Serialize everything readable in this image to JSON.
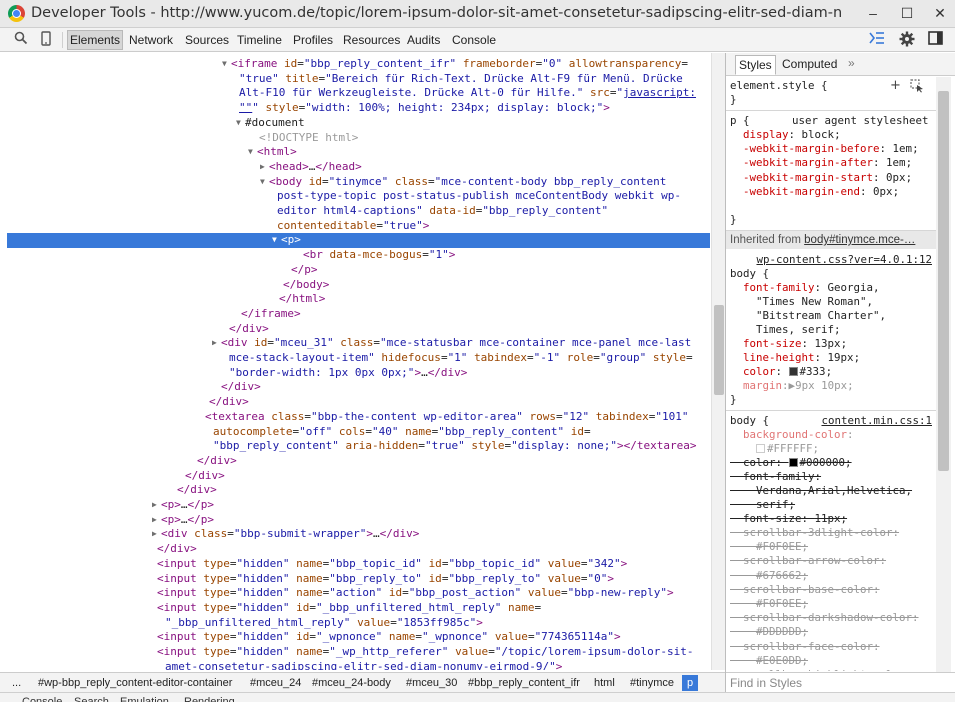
{
  "window": {
    "title": "Developer Tools - http://www.yucom.de/topic/lorem-ipsum-dolor-sit-amet-consetetur-sadipscing-elitr-sed-diam-nonumy...",
    "minimize": "–",
    "maximize": "☐",
    "close": "✕"
  },
  "toolbar": {
    "tabs": [
      "Elements",
      "Network",
      "Sources",
      "Timeline",
      "Profiles",
      "Resources",
      "Audits",
      "Console"
    ],
    "active_tab": "Elements"
  },
  "dom_rows": [
    {
      "t": "▼",
      "segs": [
        [
          "tg",
          "<iframe "
        ],
        [
          "an",
          "id"
        ],
        [
          "tx",
          "="
        ],
        [
          "av",
          "\"bbp_reply_content_ifr\""
        ],
        [
          "tx",
          " "
        ],
        [
          "an",
          "frameborder"
        ],
        [
          "tx",
          "="
        ],
        [
          "av",
          "\"0\""
        ],
        [
          "tx",
          " "
        ],
        [
          "an",
          "allowtransparency"
        ],
        [
          "tx",
          "="
        ]
      ]
    },
    {
      "segs": [
        [
          "av",
          "\"true\""
        ],
        [
          "tx",
          " "
        ],
        [
          "an",
          "title"
        ],
        [
          "tx",
          "="
        ],
        [
          "av",
          "\"Bereich für Rich-Text. Drücke Alt-F9 für Menü. Drücke"
        ]
      ]
    },
    {
      "segs": [
        [
          "av",
          "Alt-F10 für Werkzeugleiste. Drücke Alt-0 für Hilfe.\""
        ],
        [
          "tx",
          " "
        ],
        [
          "an",
          "src"
        ],
        [
          "tx",
          "="
        ],
        [
          "av",
          "\""
        ],
        [
          "lk",
          "javascript:"
        ]
      ]
    },
    {
      "segs": [
        [
          "lk",
          "\"\""
        ],
        [
          "av",
          "\""
        ],
        [
          "tx",
          " "
        ],
        [
          "an",
          "style"
        ],
        [
          "tx",
          "="
        ],
        [
          "av",
          "\"width: 100%; height: 234px; display: block;\""
        ],
        [
          "tg",
          ">"
        ]
      ]
    },
    {
      "t": "▼",
      "segs": [
        [
          "tx",
          "#document"
        ]
      ]
    },
    {
      "segs": [
        [
          "cm",
          "<!DOCTYPE html>"
        ]
      ]
    },
    {
      "t": "▼",
      "segs": [
        [
          "tg",
          "<html>"
        ]
      ]
    },
    {
      "t": "▶",
      "segs": [
        [
          "tg",
          "<head>"
        ],
        [
          "tx",
          "…"
        ],
        [
          "tg",
          "</head>"
        ]
      ]
    },
    {
      "t": "▼",
      "segs": [
        [
          "tg",
          "<body "
        ],
        [
          "an",
          "id"
        ],
        [
          "tx",
          "="
        ],
        [
          "av",
          "\"tinymce\""
        ],
        [
          "tx",
          " "
        ],
        [
          "an",
          "class"
        ],
        [
          "tx",
          "="
        ],
        [
          "av",
          "\"mce-content-body bbp_reply_content"
        ]
      ]
    },
    {
      "segs": [
        [
          "av",
          "post-type-topic post-status-publish mceContentBody webkit wp-"
        ]
      ]
    },
    {
      "segs": [
        [
          "av",
          "editor html4-captions\""
        ],
        [
          "tx",
          " "
        ],
        [
          "an",
          "data-id"
        ],
        [
          "tx",
          "="
        ],
        [
          "av",
          "\"bbp_reply_content\""
        ]
      ]
    },
    {
      "segs": [
        [
          "an",
          "contenteditable"
        ],
        [
          "tx",
          "="
        ],
        [
          "av",
          "\"true\""
        ],
        [
          "tg",
          ">"
        ]
      ]
    },
    {
      "t": "▼",
      "sel": true,
      "segs": [
        [
          "tg",
          "<p>"
        ]
      ]
    },
    {
      "segs": [
        [
          "tg",
          "<br "
        ],
        [
          "an",
          "data-mce-bogus"
        ],
        [
          "tx",
          "="
        ],
        [
          "av",
          "\"1\""
        ],
        [
          "tg",
          ">"
        ]
      ]
    },
    {
      "segs": [
        [
          "tg",
          "</p>"
        ]
      ]
    },
    {
      "segs": [
        [
          "tg",
          "</body>"
        ]
      ]
    },
    {
      "segs": [
        [
          "tg",
          "</html>"
        ]
      ]
    },
    {
      "segs": [
        [
          "tg",
          "</iframe>"
        ]
      ]
    },
    {
      "segs": [
        [
          "tg",
          "</div>"
        ]
      ]
    },
    {
      "t": "▶",
      "segs": [
        [
          "tg",
          "<div "
        ],
        [
          "an",
          "id"
        ],
        [
          "tx",
          "="
        ],
        [
          "av",
          "\"mceu_31\""
        ],
        [
          "tx",
          " "
        ],
        [
          "an",
          "class"
        ],
        [
          "tx",
          "="
        ],
        [
          "av",
          "\"mce-statusbar mce-container mce-panel mce-last"
        ]
      ]
    },
    {
      "segs": [
        [
          "av",
          "mce-stack-layout-item\""
        ],
        [
          "tx",
          " "
        ],
        [
          "an",
          "hidefocus"
        ],
        [
          "tx",
          "="
        ],
        [
          "av",
          "\"1\""
        ],
        [
          "tx",
          " "
        ],
        [
          "an",
          "tabindex"
        ],
        [
          "tx",
          "="
        ],
        [
          "av",
          "\"-1\""
        ],
        [
          "tx",
          " "
        ],
        [
          "an",
          "role"
        ],
        [
          "tx",
          "="
        ],
        [
          "av",
          "\"group\""
        ],
        [
          "tx",
          " "
        ],
        [
          "an",
          "style"
        ],
        [
          "tx",
          "="
        ]
      ]
    },
    {
      "segs": [
        [
          "av",
          "\"border-width: 1px 0px 0px;\""
        ],
        [
          "tg",
          ">"
        ],
        [
          "tx",
          "…"
        ],
        [
          "tg",
          "</div>"
        ]
      ]
    },
    {
      "segs": [
        [
          "tg",
          "</div>"
        ]
      ]
    },
    {
      "segs": [
        [
          "tg",
          "</div>"
        ]
      ]
    },
    {
      "segs": [
        [
          "tg",
          "<textarea "
        ],
        [
          "an",
          "class"
        ],
        [
          "tx",
          "="
        ],
        [
          "av",
          "\"bbp-the-content wp-editor-area\""
        ],
        [
          "tx",
          " "
        ],
        [
          "an",
          "rows"
        ],
        [
          "tx",
          "="
        ],
        [
          "av",
          "\"12\""
        ],
        [
          "tx",
          " "
        ],
        [
          "an",
          "tabindex"
        ],
        [
          "tx",
          "="
        ],
        [
          "av",
          "\"101\""
        ]
      ]
    },
    {
      "segs": [
        [
          "an",
          "autocomplete"
        ],
        [
          "tx",
          "="
        ],
        [
          "av",
          "\"off\""
        ],
        [
          "tx",
          " "
        ],
        [
          "an",
          "cols"
        ],
        [
          "tx",
          "="
        ],
        [
          "av",
          "\"40\""
        ],
        [
          "tx",
          " "
        ],
        [
          "an",
          "name"
        ],
        [
          "tx",
          "="
        ],
        [
          "av",
          "\"bbp_reply_content\""
        ],
        [
          "tx",
          " "
        ],
        [
          "an",
          "id"
        ],
        [
          "tx",
          "="
        ]
      ]
    },
    {
      "segs": [
        [
          "av",
          "\"bbp_reply_content\""
        ],
        [
          "tx",
          " "
        ],
        [
          "an",
          "aria-hidden"
        ],
        [
          "tx",
          "="
        ],
        [
          "av",
          "\"true\""
        ],
        [
          "tx",
          " "
        ],
        [
          "an",
          "style"
        ],
        [
          "tx",
          "="
        ],
        [
          "av",
          "\"display: none;\""
        ],
        [
          "tg",
          ">"
        ],
        [
          "tg",
          "</textarea>"
        ]
      ]
    },
    {
      "segs": [
        [
          "tg",
          "</div>"
        ]
      ]
    },
    {
      "segs": [
        [
          "tg",
          "</div>"
        ]
      ]
    },
    {
      "segs": [
        [
          "tg",
          "</div>"
        ]
      ]
    },
    {
      "t": "▶",
      "segs": [
        [
          "tg",
          "<p>"
        ],
        [
          "tx",
          "…"
        ],
        [
          "tg",
          "</p>"
        ]
      ]
    },
    {
      "t": "▶",
      "segs": [
        [
          "tg",
          "<p>"
        ],
        [
          "tx",
          "…"
        ],
        [
          "tg",
          "</p>"
        ]
      ]
    },
    {
      "t": "▶",
      "segs": [
        [
          "tg",
          "<div "
        ],
        [
          "an",
          "class"
        ],
        [
          "tx",
          "="
        ],
        [
          "av",
          "\"bbp-submit-wrapper\""
        ],
        [
          "tg",
          ">"
        ],
        [
          "tx",
          "…"
        ],
        [
          "tg",
          "</div>"
        ]
      ]
    },
    {
      "segs": [
        [
          "tg",
          "</div>"
        ]
      ]
    },
    {
      "segs": [
        [
          "tg",
          "<input "
        ],
        [
          "an",
          "type"
        ],
        [
          "tx",
          "="
        ],
        [
          "av",
          "\"hidden\""
        ],
        [
          "tx",
          " "
        ],
        [
          "an",
          "name"
        ],
        [
          "tx",
          "="
        ],
        [
          "av",
          "\"bbp_topic_id\""
        ],
        [
          "tx",
          " "
        ],
        [
          "an",
          "id"
        ],
        [
          "tx",
          "="
        ],
        [
          "av",
          "\"bbp_topic_id\""
        ],
        [
          "tx",
          " "
        ],
        [
          "an",
          "value"
        ],
        [
          "tx",
          "="
        ],
        [
          "av",
          "\"342\""
        ],
        [
          "tg",
          ">"
        ]
      ]
    },
    {
      "segs": [
        [
          "tg",
          "<input "
        ],
        [
          "an",
          "type"
        ],
        [
          "tx",
          "="
        ],
        [
          "av",
          "\"hidden\""
        ],
        [
          "tx",
          " "
        ],
        [
          "an",
          "name"
        ],
        [
          "tx",
          "="
        ],
        [
          "av",
          "\"bbp_reply_to\""
        ],
        [
          "tx",
          " "
        ],
        [
          "an",
          "id"
        ],
        [
          "tx",
          "="
        ],
        [
          "av",
          "\"bbp_reply_to\""
        ],
        [
          "tx",
          " "
        ],
        [
          "an",
          "value"
        ],
        [
          "tx",
          "="
        ],
        [
          "av",
          "\"0\""
        ],
        [
          "tg",
          ">"
        ]
      ]
    },
    {
      "segs": [
        [
          "tg",
          "<input "
        ],
        [
          "an",
          "type"
        ],
        [
          "tx",
          "="
        ],
        [
          "av",
          "\"hidden\""
        ],
        [
          "tx",
          " "
        ],
        [
          "an",
          "name"
        ],
        [
          "tx",
          "="
        ],
        [
          "av",
          "\"action\""
        ],
        [
          "tx",
          " "
        ],
        [
          "an",
          "id"
        ],
        [
          "tx",
          "="
        ],
        [
          "av",
          "\"bbp_post_action\""
        ],
        [
          "tx",
          " "
        ],
        [
          "an",
          "value"
        ],
        [
          "tx",
          "="
        ],
        [
          "av",
          "\"bbp-new-reply\""
        ],
        [
          "tg",
          ">"
        ]
      ]
    },
    {
      "segs": [
        [
          "tg",
          "<input "
        ],
        [
          "an",
          "type"
        ],
        [
          "tx",
          "="
        ],
        [
          "av",
          "\"hidden\""
        ],
        [
          "tx",
          " "
        ],
        [
          "an",
          "id"
        ],
        [
          "tx",
          "="
        ],
        [
          "av",
          "\"_bbp_unfiltered_html_reply\""
        ],
        [
          "tx",
          " "
        ],
        [
          "an",
          "name"
        ],
        [
          "tx",
          "="
        ]
      ]
    },
    {
      "segs": [
        [
          "av",
          "\"_bbp_unfiltered_html_reply\""
        ],
        [
          "tx",
          " "
        ],
        [
          "an",
          "value"
        ],
        [
          "tx",
          "="
        ],
        [
          "av",
          "\"1853ff985c\""
        ],
        [
          "tg",
          ">"
        ]
      ]
    },
    {
      "segs": [
        [
          "tg",
          "<input "
        ],
        [
          "an",
          "type"
        ],
        [
          "tx",
          "="
        ],
        [
          "av",
          "\"hidden\""
        ],
        [
          "tx",
          " "
        ],
        [
          "an",
          "id"
        ],
        [
          "tx",
          "="
        ],
        [
          "av",
          "\"_wpnonce\""
        ],
        [
          "tx",
          " "
        ],
        [
          "an",
          "name"
        ],
        [
          "tx",
          "="
        ],
        [
          "av",
          "\"_wpnonce\""
        ],
        [
          "tx",
          " "
        ],
        [
          "an",
          "value"
        ],
        [
          "tx",
          "="
        ],
        [
          "av",
          "\"774365114a\""
        ],
        [
          "tg",
          ">"
        ]
      ]
    },
    {
      "segs": [
        [
          "tg",
          "<input "
        ],
        [
          "an",
          "type"
        ],
        [
          "tx",
          "="
        ],
        [
          "av",
          "\"hidden\""
        ],
        [
          "tx",
          " "
        ],
        [
          "an",
          "name"
        ],
        [
          "tx",
          "="
        ],
        [
          "av",
          "\"_wp_http_referer\""
        ],
        [
          "tx",
          " "
        ],
        [
          "an",
          "value"
        ],
        [
          "tx",
          "="
        ],
        [
          "av",
          "\"/topic/lorem-ipsum-dolor-sit-"
        ]
      ]
    },
    {
      "segs": [
        [
          "av",
          "amet-consetetur-sadipscing-elitr-sed-diam-nonumy-eirmod-9/\""
        ],
        [
          "tg",
          ">"
        ]
      ]
    }
  ],
  "sidebar": {
    "tabs": [
      "Styles",
      "Computed"
    ],
    "more": "»",
    "element_style": "element.style {",
    "close_brace": "}",
    "ua_selector": "p {",
    "ua_source": "user agent stylesheet",
    "ua_props": [
      [
        "display",
        "block"
      ],
      [
        "-webkit-margin-before",
        "1em"
      ],
      [
        "-webkit-margin-after",
        "1em"
      ],
      [
        "-webkit-margin-start",
        "0px"
      ],
      [
        "-webkit-margin-end",
        "0px"
      ]
    ],
    "inherited_label": "Inherited from",
    "inherited_from": "body#tinymce.mce-…",
    "rule1_source": "wp-content.css?ver=4.0.1:12",
    "rule1_selector": "body {",
    "rule1_font_family_name": "font-family",
    "rule1_font_family_lines": [
      "Georgia,",
      "\"Times New Roman\",",
      "\"Bitstream Charter\",",
      "Times, serif;"
    ],
    "rule1_props": [
      [
        "font-size",
        "13px"
      ],
      [
        "line-height",
        "19px"
      ]
    ],
    "rule1_color_name": "color",
    "rule1_color_value": "#333",
    "rule1_color_swatch": "#333333",
    "rule1_margin_name": "margin",
    "rule1_margin_value": "9px 10px",
    "rule2_source": "content.min.css:1",
    "rule2_selector": "body {",
    "rule2_bg_name": "background-color",
    "rule2_bg_value": "#FFFFFF;",
    "rule2_bg_swatch": "#ffffff",
    "rule2_color_name": "color",
    "rule2_color_value": "#000000;",
    "rule2_color_swatch": "#000000",
    "rule2_ff_name": "font-family",
    "rule2_ff_lines": [
      "Verdana,Arial,Helvetica,",
      "serif;"
    ],
    "rule2_fs_name": "font-size",
    "rule2_fs_value": "11px;",
    "rule2_scrollbar": [
      [
        "scrollbar-3dlight-color",
        "#F0F0EE;"
      ],
      [
        "scrollbar-arrow-color",
        "#676662;"
      ],
      [
        "scrollbar-base-color",
        "#F0F0EE;"
      ],
      [
        "scrollbar-darkshadow-color",
        "#DDDDDD;"
      ],
      [
        "scrollbar-face-color",
        "#E0E0DD;"
      ],
      [
        "scrollbar-highlight-color",
        ""
      ]
    ],
    "find_placeholder": "Find in Styles"
  },
  "breadcrumbs": [
    "...",
    "#wp-bbp_reply_content-editor-container",
    "#mceu_24",
    "#mceu_24-body",
    "#mceu_30",
    "#bbp_reply_content_ifr",
    "html",
    "#tinymce",
    "p"
  ],
  "drawer_tabs": [
    "Console",
    "Search",
    "Emulation",
    "Rendering"
  ]
}
